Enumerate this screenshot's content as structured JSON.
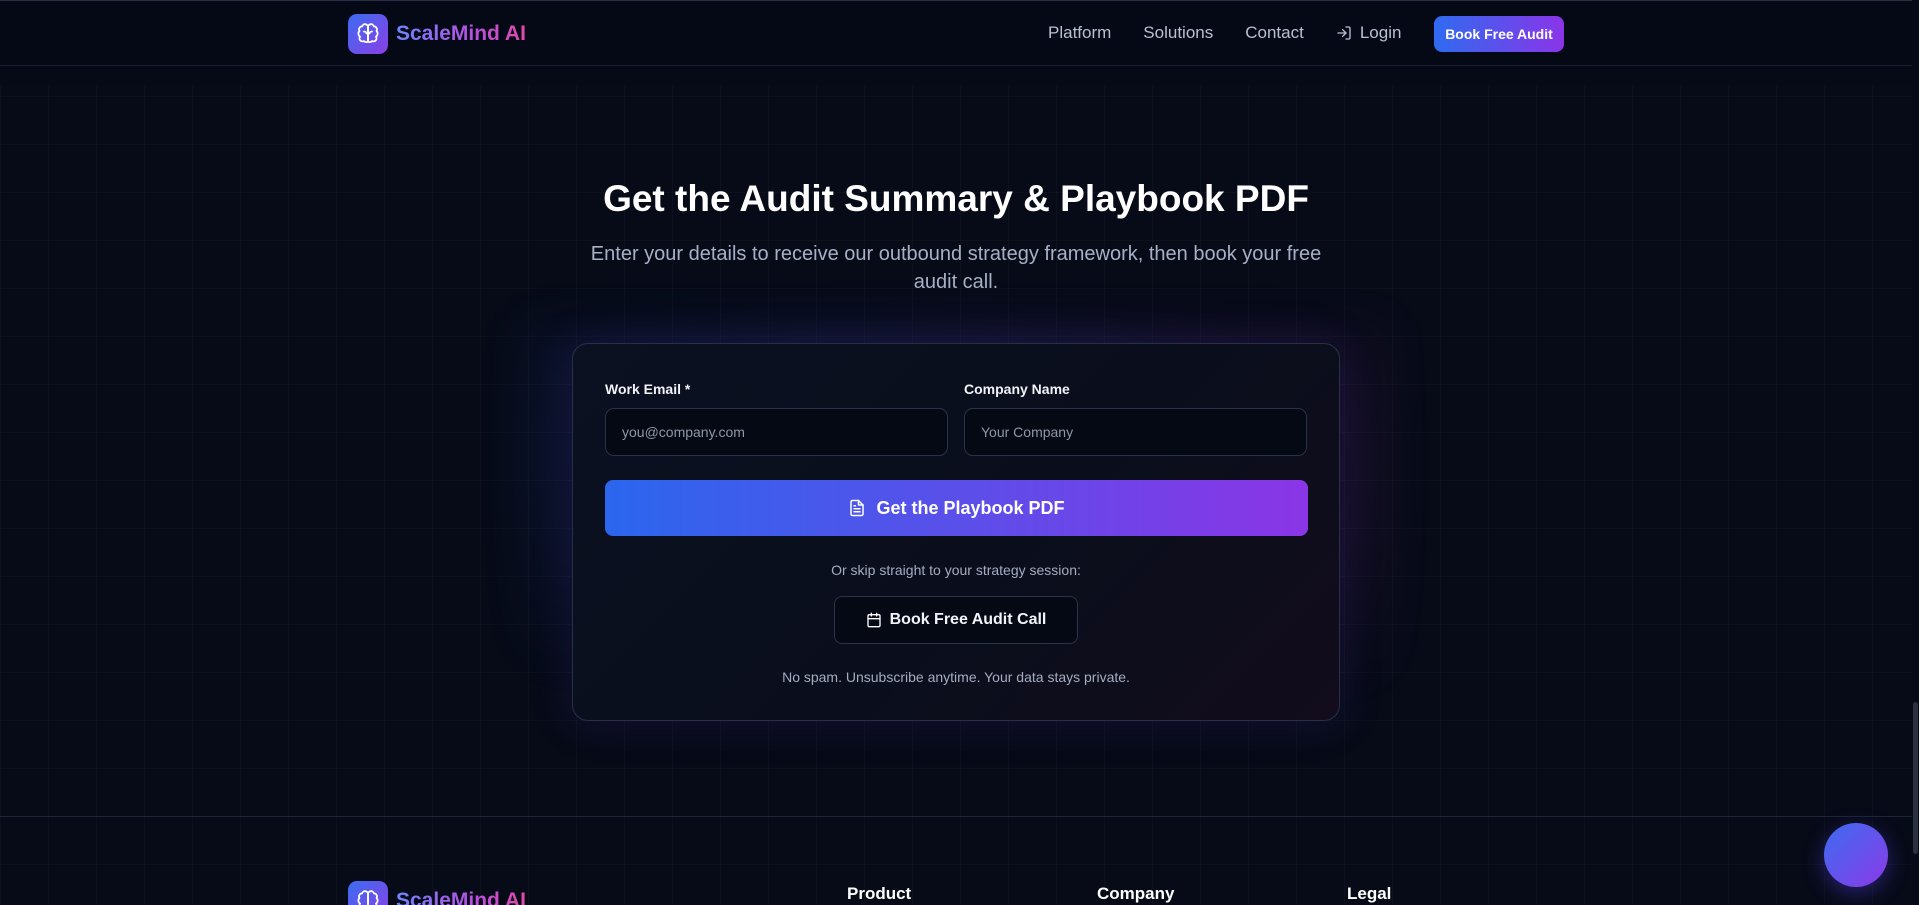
{
  "nav": {
    "brand": "ScaleMind AI",
    "links": [
      "Platform",
      "Solutions",
      "Contact"
    ],
    "login": "Login",
    "cta": "Book Free Audit"
  },
  "hero": {
    "title": "Get the Audit Summary & Playbook PDF",
    "subtitle": "Enter your details to receive our outbound strategy framework, then book your free audit call."
  },
  "form": {
    "email_label": "Work Email *",
    "email_placeholder": "you@company.com",
    "email_value": "",
    "company_label": "Company Name",
    "company_placeholder": "Your Company",
    "company_value": "",
    "submit": "Get the Playbook PDF",
    "skip_text": "Or skip straight to your strategy session:",
    "secondary": "Book Free Audit Call",
    "privacy": "No spam. Unsubscribe anytime. Your data stays private."
  },
  "footer": {
    "brand": "ScaleMind AI",
    "columns": [
      "Product",
      "Company",
      "Legal"
    ]
  },
  "colors": {
    "background": "#070b18",
    "accent_blue": "#2f6bf0",
    "accent_purple": "#8a35e8"
  },
  "icons": [
    "brain-icon",
    "login-icon",
    "file-icon",
    "calendar-icon"
  ]
}
